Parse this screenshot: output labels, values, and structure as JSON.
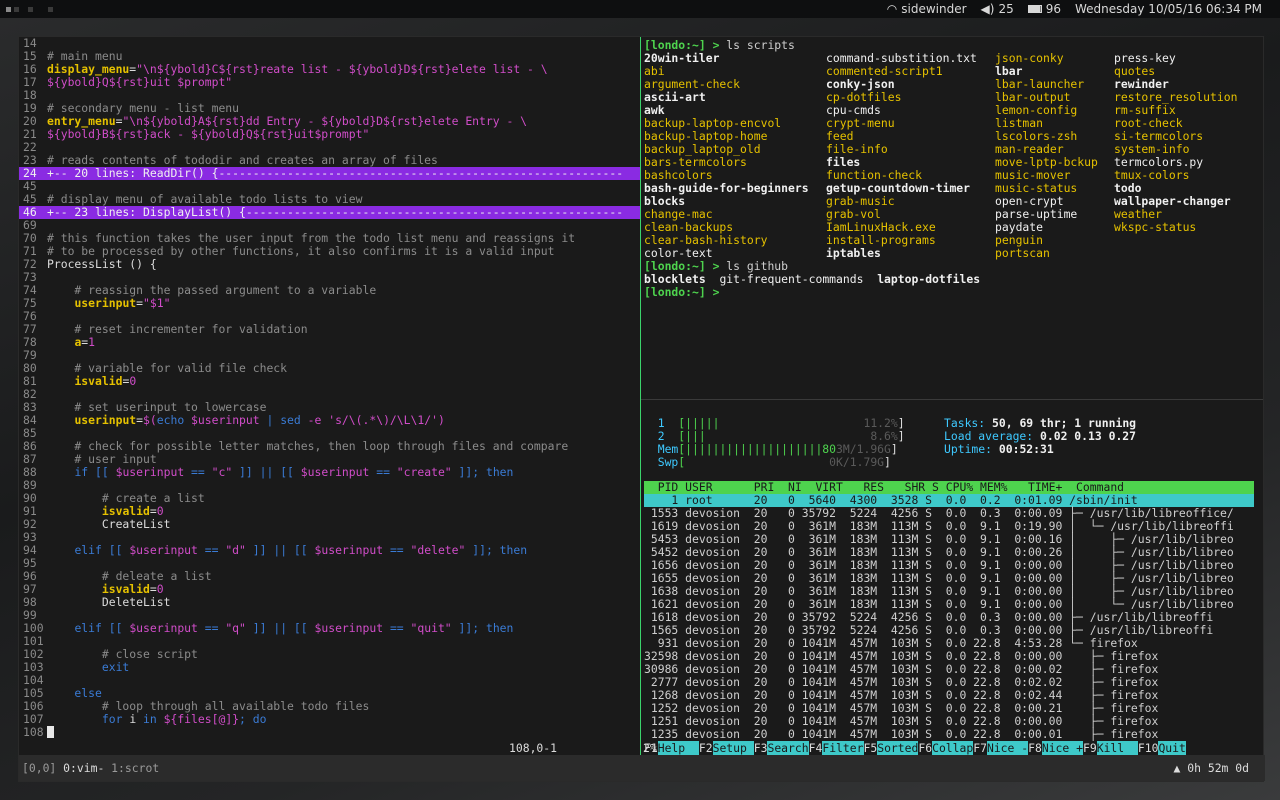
{
  "topbar": {
    "hostname": "sidewinder",
    "volume": "25",
    "battery": "96",
    "datetime": "Wednesday 10/05/16 06:34 PM"
  },
  "vim": {
    "lines": [
      {
        "n": "14",
        "t": ""
      },
      {
        "n": "15",
        "cls": "cm",
        "t": "# main menu"
      },
      {
        "n": "16",
        "html": "<span class='var'>display_menu</span><span class='pl'>=</span><span class='str'>\"\\n${ybold}C${rst}reate list - ${ybold}D${rst}elete list - \\</span>"
      },
      {
        "n": "17",
        "html": "<span class='str'>${ybold}Q${rst}uit $prompt\"</span>"
      },
      {
        "n": "18",
        "t": ""
      },
      {
        "n": "19",
        "cls": "cm",
        "t": "# secondary menu - list menu"
      },
      {
        "n": "20",
        "html": "<span class='var'>entry_menu</span><span class='pl'>=</span><span class='str'>\"\\n${ybold}A${rst}dd Entry - ${ybold}D${rst}elete Entry - \\</span>"
      },
      {
        "n": "21",
        "html": "<span class='str'>${ybold}B${rst}ack - ${ybold}Q${rst}uit$prompt\"</span>"
      },
      {
        "n": "22",
        "t": ""
      },
      {
        "n": "23",
        "cls": "cm",
        "t": "# reads contents of tododir and creates an array of files"
      },
      {
        "n": "24",
        "fold": true,
        "t": "+-- 20 lines: ReadDir() {-----------------------------------------------------------"
      },
      {
        "n": "45",
        "t": ""
      },
      {
        "n": "45",
        "cls": "cm",
        "t": "# display menu of available todo lists to view"
      },
      {
        "n": "46",
        "fold": true,
        "t": "+-- 23 lines: DisplayList() {-------------------------------------------------------"
      },
      {
        "n": "69",
        "t": ""
      },
      {
        "n": "70",
        "cls": "cm",
        "t": "# this function takes the user input from the todo list menu and reassigns it"
      },
      {
        "n": "71",
        "cls": "cm",
        "t": "# to be processed by other functions, it also confirms it is a valid input"
      },
      {
        "n": "72",
        "cls": "pl",
        "t": "ProcessList () {"
      },
      {
        "n": "73",
        "t": ""
      },
      {
        "n": "74",
        "cls": "cm",
        "t": "    # reassign the passed argument to a variable"
      },
      {
        "n": "75",
        "html": "    <span class='var'>userinput</span><span class='pl'>=</span><span class='str'>\"$1\"</span>"
      },
      {
        "n": "76",
        "t": ""
      },
      {
        "n": "77",
        "cls": "cm",
        "t": "    # reset incrementer for validation"
      },
      {
        "n": "78",
        "html": "    <span class='var'>a</span><span class='pl'>=</span><span class='str'>1</span>"
      },
      {
        "n": "79",
        "t": ""
      },
      {
        "n": "80",
        "cls": "cm",
        "t": "    # variable for valid file check"
      },
      {
        "n": "81",
        "html": "    <span class='var'>isvalid</span><span class='pl'>=</span><span class='str'>0</span>"
      },
      {
        "n": "82",
        "t": ""
      },
      {
        "n": "83",
        "cls": "cm",
        "t": "    # set userinput to lowercase"
      },
      {
        "n": "84",
        "html": "    <span class='var'>userinput</span><span class='pl'>=</span><span class='str'>$(</span><span class='kw'>echo</span> <span class='str'>$userinput</span> <span class='kw'>|</span> <span class='kw'>sed</span> <span class='str'>-e 's/\\(.*\\)/\\L\\1/')</span>"
      },
      {
        "n": "85",
        "t": ""
      },
      {
        "n": "86",
        "cls": "cm",
        "t": "    # check for possible letter matches, then loop through files and compare"
      },
      {
        "n": "87",
        "cls": "cm",
        "t": "    # user input"
      },
      {
        "n": "88",
        "html": "    <span class='kw'>if [[</span> <span class='str'>$userinput</span> <span class='kw'>==</span> <span class='str'>\"c\"</span> <span class='kw'>]] || [[</span> <span class='str'>$userinput</span> <span class='kw'>==</span> <span class='str'>\"create\"</span> <span class='kw'>]]; then</span>"
      },
      {
        "n": "89",
        "t": ""
      },
      {
        "n": "90",
        "cls": "cm",
        "t": "        # create a list"
      },
      {
        "n": "91",
        "html": "        <span class='var'>isvalid</span><span class='pl'>=</span><span class='str'>0</span>"
      },
      {
        "n": "92",
        "cls": "pl",
        "t": "        CreateList"
      },
      {
        "n": "93",
        "t": ""
      },
      {
        "n": "94",
        "html": "    <span class='kw'>elif [[</span> <span class='str'>$userinput</span> <span class='kw'>==</span> <span class='str'>\"d\"</span> <span class='kw'>]] || [[</span> <span class='str'>$userinput</span> <span class='kw'>==</span> <span class='str'>\"delete\"</span> <span class='kw'>]]; then</span>"
      },
      {
        "n": "95",
        "t": ""
      },
      {
        "n": "96",
        "cls": "cm",
        "t": "        # deleate a list"
      },
      {
        "n": "97",
        "html": "        <span class='var'>isvalid</span><span class='pl'>=</span><span class='str'>0</span>"
      },
      {
        "n": "98",
        "cls": "pl",
        "t": "        DeleteList"
      },
      {
        "n": "99",
        "t": ""
      },
      {
        "n": "100",
        "html": "    <span class='kw'>elif [[</span> <span class='str'>$userinput</span> <span class='kw'>==</span> <span class='str'>\"q\"</span> <span class='kw'>]] || [[</span> <span class='str'>$userinput</span> <span class='kw'>==</span> <span class='str'>\"quit\"</span> <span class='kw'>]]; then</span>"
      },
      {
        "n": "101",
        "t": ""
      },
      {
        "n": "102",
        "cls": "cm",
        "t": "        # close script"
      },
      {
        "n": "103",
        "cls": "kw",
        "t": "        exit"
      },
      {
        "n": "104",
        "t": ""
      },
      {
        "n": "105",
        "cls": "kw",
        "t": "    else"
      },
      {
        "n": "106",
        "cls": "cm",
        "t": "        # loop through all available todo files"
      },
      {
        "n": "107",
        "html": "        <span class='kw'>for</span> <span class='pl'>i</span> <span class='kw'>in</span> <span class='str'>${files[@]}</span><span class='kw'>; do</span>"
      },
      {
        "n": "108",
        "cursor": true,
        "t": ""
      }
    ],
    "position": "108,0-1",
    "percent": "2%"
  },
  "shell": {
    "prompt": "[londo:~] >",
    "cmd1": "ls scripts",
    "cmd2": "ls github",
    "scripts": [
      [
        {
          "t": "20win-tiler",
          "c": "w"
        },
        {
          "t": "abi",
          "c": "y"
        },
        {
          "t": "argument-check",
          "c": "y"
        },
        {
          "t": "ascii-art",
          "c": "w"
        },
        {
          "t": "awk",
          "c": "w"
        },
        {
          "t": "backup-laptop-encvol",
          "c": "y"
        },
        {
          "t": "backup-laptop-home",
          "c": "y"
        },
        {
          "t": "backup_laptop_old",
          "c": "y"
        },
        {
          "t": "bars-termcolors",
          "c": "y"
        },
        {
          "t": "bashcolors",
          "c": "y"
        },
        {
          "t": "bash-guide-for-beginners",
          "c": "w"
        },
        {
          "t": "blocks",
          "c": "w"
        },
        {
          "t": "change-mac",
          "c": "y"
        },
        {
          "t": "clean-backups",
          "c": "y"
        },
        {
          "t": "clear-bash-history",
          "c": "y"
        },
        {
          "t": "color-text",
          "c": "p"
        }
      ],
      [
        {
          "t": "command-substition.txt",
          "c": "p"
        },
        {
          "t": "commented-script1",
          "c": "y"
        },
        {
          "t": "conky-json",
          "c": "w"
        },
        {
          "t": "cp-dotfiles",
          "c": "y"
        },
        {
          "t": "cpu-cmds",
          "c": "p"
        },
        {
          "t": "crypt-menu",
          "c": "y"
        },
        {
          "t": "feed",
          "c": "y"
        },
        {
          "t": "file-info",
          "c": "y"
        },
        {
          "t": "files",
          "c": "w"
        },
        {
          "t": "function-check",
          "c": "y"
        },
        {
          "t": "getup-countdown-timer",
          "c": "w"
        },
        {
          "t": "grab-music",
          "c": "y"
        },
        {
          "t": "grab-vol",
          "c": "y"
        },
        {
          "t": "IamLinuxHack.exe",
          "c": "y"
        },
        {
          "t": "install-programs",
          "c": "y"
        },
        {
          "t": "iptables",
          "c": "w"
        }
      ],
      [
        {
          "t": "json-conky",
          "c": "y"
        },
        {
          "t": "lbar",
          "c": "w"
        },
        {
          "t": "lbar-launcher",
          "c": "y"
        },
        {
          "t": "lbar-output",
          "c": "y"
        },
        {
          "t": "lemon-config",
          "c": "y"
        },
        {
          "t": "listman",
          "c": "y"
        },
        {
          "t": "lscolors-zsh",
          "c": "y"
        },
        {
          "t": "man-reader",
          "c": "y"
        },
        {
          "t": "move-lptp-bckup",
          "c": "y"
        },
        {
          "t": "music-mover",
          "c": "y"
        },
        {
          "t": "music-status",
          "c": "y"
        },
        {
          "t": "open-crypt",
          "c": "p"
        },
        {
          "t": "parse-uptime",
          "c": "p"
        },
        {
          "t": "paydate",
          "c": "p"
        },
        {
          "t": "penguin",
          "c": "y"
        },
        {
          "t": "portscan",
          "c": "y"
        }
      ],
      [
        {
          "t": "press-key",
          "c": "p"
        },
        {
          "t": "quotes",
          "c": "y"
        },
        {
          "t": "rewinder",
          "c": "w"
        },
        {
          "t": "restore_resolution",
          "c": "y"
        },
        {
          "t": "rm-suffix",
          "c": "y"
        },
        {
          "t": "root-check",
          "c": "y"
        },
        {
          "t": "si-termcolors",
          "c": "y"
        },
        {
          "t": "system-info",
          "c": "y"
        },
        {
          "t": "termcolors.py",
          "c": "p"
        },
        {
          "t": "tmux-colors",
          "c": "y"
        },
        {
          "t": "todo",
          "c": "w"
        },
        {
          "t": "wallpaper-changer",
          "c": "w"
        },
        {
          "t": "weather",
          "c": "y"
        },
        {
          "t": "wkspc-status",
          "c": "y"
        },
        {
          "t": "",
          "c": "p"
        },
        {
          "t": "",
          "c": "p"
        }
      ]
    ],
    "github": "<span class='c-w'>blocklets</span>  <span class='c-p'>git-frequent-commands</span>  <span class='c-w'>laptop-dotfiles</span>"
  },
  "htop": {
    "meters": [
      {
        "label": "  1",
        "bar": "[|||||",
        "pct": "11.2%]"
      },
      {
        "label": "  2",
        "bar": "[|||",
        "pct": "8.6%]"
      },
      {
        "label": "  Mem",
        "bar": "[||||||||||||||||||||80",
        "pct": "3M/1.96G]"
      },
      {
        "label": "  Swp",
        "bar": "[",
        "pct": "0K/1.79G]"
      }
    ],
    "tasks": "50, 69 thr; 1 running",
    "load": "0.02 0.13 0.27",
    "uptime": "00:52:31",
    "header": "  PID USER      PRI  NI  VIRT   RES   SHR S CPU% MEM%   TIME+  Command",
    "rows": [
      {
        "pid": "1",
        "user": "root",
        "pri": "20",
        "ni": "0",
        "virt": "5640",
        "res": "4300",
        "shr": "3528",
        "s": "S",
        "cpu": "0.0",
        "mem": "0.2",
        "time": "0:01.09",
        "cmd": "/sbin/init",
        "sel": true
      },
      {
        "pid": "1553",
        "user": "devosion",
        "pri": "20",
        "ni": "0",
        "virt": "35792",
        "res": "5224",
        "shr": "4256",
        "s": "S",
        "cpu": "0.0",
        "mem": "0.3",
        "time": "0:00.09",
        "cmd": "├─ /usr/lib/libreoffice/"
      },
      {
        "pid": "1619",
        "user": "devosion",
        "pri": "20",
        "ni": "0",
        "virt": "361M",
        "res": "183M",
        "shr": "113M",
        "s": "S",
        "cpu": "0.0",
        "mem": "9.1",
        "time": "0:19.90",
        "cmd": "│  └─ /usr/lib/libreoffi"
      },
      {
        "pid": "5453",
        "user": "devosion",
        "pri": "20",
        "ni": "0",
        "virt": "361M",
        "res": "183M",
        "shr": "113M",
        "s": "S",
        "cpu": "0.0",
        "mem": "9.1",
        "time": "0:00.16",
        "cmd": "│     ├─ /usr/lib/libreo"
      },
      {
        "pid": "5452",
        "user": "devosion",
        "pri": "20",
        "ni": "0",
        "virt": "361M",
        "res": "183M",
        "shr": "113M",
        "s": "S",
        "cpu": "0.0",
        "mem": "9.1",
        "time": "0:00.26",
        "cmd": "│     ├─ /usr/lib/libreo"
      },
      {
        "pid": "1656",
        "user": "devosion",
        "pri": "20",
        "ni": "0",
        "virt": "361M",
        "res": "183M",
        "shr": "113M",
        "s": "S",
        "cpu": "0.0",
        "mem": "9.1",
        "time": "0:00.00",
        "cmd": "│     ├─ /usr/lib/libreo"
      },
      {
        "pid": "1655",
        "user": "devosion",
        "pri": "20",
        "ni": "0",
        "virt": "361M",
        "res": "183M",
        "shr": "113M",
        "s": "S",
        "cpu": "0.0",
        "mem": "9.1",
        "time": "0:00.00",
        "cmd": "│     ├─ /usr/lib/libreo"
      },
      {
        "pid": "1638",
        "user": "devosion",
        "pri": "20",
        "ni": "0",
        "virt": "361M",
        "res": "183M",
        "shr": "113M",
        "s": "S",
        "cpu": "0.0",
        "mem": "9.1",
        "time": "0:00.00",
        "cmd": "│     ├─ /usr/lib/libreo"
      },
      {
        "pid": "1621",
        "user": "devosion",
        "pri": "20",
        "ni": "0",
        "virt": "361M",
        "res": "183M",
        "shr": "113M",
        "s": "S",
        "cpu": "0.0",
        "mem": "9.1",
        "time": "0:00.00",
        "cmd": "│     └─ /usr/lib/libreo"
      },
      {
        "pid": "1618",
        "user": "devosion",
        "pri": "20",
        "ni": "0",
        "virt": "35792",
        "res": "5224",
        "shr": "4256",
        "s": "S",
        "cpu": "0.0",
        "mem": "0.3",
        "time": "0:00.00",
        "cmd": "├─ /usr/lib/libreoffi"
      },
      {
        "pid": "1565",
        "user": "devosion",
        "pri": "20",
        "ni": "0",
        "virt": "35792",
        "res": "5224",
        "shr": "4256",
        "s": "S",
        "cpu": "0.0",
        "mem": "0.3",
        "time": "0:00.00",
        "cmd": "├─ /usr/lib/libreoffi"
      },
      {
        "pid": "931",
        "user": "devosion",
        "pri": "20",
        "ni": "0",
        "virt": "1041M",
        "res": "457M",
        "shr": "103M",
        "s": "S",
        "cpu": "0.0",
        "mem": "22.8",
        "time": "4:53.28",
        "cmd": "└─ firefox"
      },
      {
        "pid": "32598",
        "user": "devosion",
        "pri": "20",
        "ni": "0",
        "virt": "1041M",
        "res": "457M",
        "shr": "103M",
        "s": "S",
        "cpu": "0.0",
        "mem": "22.8",
        "time": "0:00.00",
        "cmd": "   ├─ firefox"
      },
      {
        "pid": "30986",
        "user": "devosion",
        "pri": "20",
        "ni": "0",
        "virt": "1041M",
        "res": "457M",
        "shr": "103M",
        "s": "S",
        "cpu": "0.0",
        "mem": "22.8",
        "time": "0:00.02",
        "cmd": "   ├─ firefox"
      },
      {
        "pid": "2777",
        "user": "devosion",
        "pri": "20",
        "ni": "0",
        "virt": "1041M",
        "res": "457M",
        "shr": "103M",
        "s": "S",
        "cpu": "0.0",
        "mem": "22.8",
        "time": "0:02.02",
        "cmd": "   ├─ firefox"
      },
      {
        "pid": "1268",
        "user": "devosion",
        "pri": "20",
        "ni": "0",
        "virt": "1041M",
        "res": "457M",
        "shr": "103M",
        "s": "S",
        "cpu": "0.0",
        "mem": "22.8",
        "time": "0:02.44",
        "cmd": "   ├─ firefox"
      },
      {
        "pid": "1252",
        "user": "devosion",
        "pri": "20",
        "ni": "0",
        "virt": "1041M",
        "res": "457M",
        "shr": "103M",
        "s": "S",
        "cpu": "0.0",
        "mem": "22.8",
        "time": "0:00.21",
        "cmd": "   ├─ firefox"
      },
      {
        "pid": "1251",
        "user": "devosion",
        "pri": "20",
        "ni": "0",
        "virt": "1041M",
        "res": "457M",
        "shr": "103M",
        "s": "S",
        "cpu": "0.0",
        "mem": "22.8",
        "time": "0:00.00",
        "cmd": "   ├─ firefox"
      },
      {
        "pid": "1235",
        "user": "devosion",
        "pri": "20",
        "ni": "0",
        "virt": "1041M",
        "res": "457M",
        "shr": "103M",
        "s": "S",
        "cpu": "0.0",
        "mem": "22.8",
        "time": "0:00.01",
        "cmd": "   ├─ firefox"
      }
    ],
    "fkeys": [
      {
        "k": "F1",
        "l": "Help  "
      },
      {
        "k": "F2",
        "l": "Setup "
      },
      {
        "k": "F3",
        "l": "Search"
      },
      {
        "k": "F4",
        "l": "Filter"
      },
      {
        "k": "F5",
        "l": "Sorted"
      },
      {
        "k": "F6",
        "l": "Collap"
      },
      {
        "k": "F7",
        "l": "Nice -"
      },
      {
        "k": "F8",
        "l": "Nice +"
      },
      {
        "k": "F9",
        "l": "Kill  "
      },
      {
        "k": "F10",
        "l": "Quit"
      }
    ]
  },
  "tmux": {
    "left": "[0,0]",
    "win0": "0:vim-",
    "win1": "1:scrot",
    "right": "0h 52m 0d"
  },
  "colors": {
    "accent_green": "#4ed34e",
    "fold_purple": "#8a2be2",
    "htop_cyan": "#3ec9c9",
    "yellow": "#e5c100"
  }
}
